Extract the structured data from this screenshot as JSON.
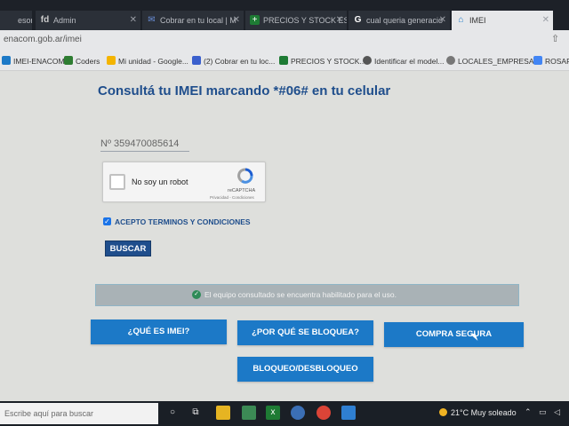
{
  "tabs": [
    {
      "label": "esor",
      "icon": ""
    },
    {
      "label": "Admin",
      "icon": "fd"
    },
    {
      "label": "Cobrar en tu local | M",
      "icon": "✉"
    },
    {
      "label": "PRECIOS Y STOCK ES",
      "icon": "+"
    },
    {
      "label": "cual queria generacio",
      "icon": "G"
    },
    {
      "label": "IMEI",
      "icon": "⌂"
    }
  ],
  "address": {
    "url": "enacom.gob.ar/imei"
  },
  "bookmarks": [
    {
      "label": "IMEI-ENACOM",
      "color": "#1c79c7"
    },
    {
      "label": "Coders",
      "color": "#2e7d32"
    },
    {
      "label": "Mi unidad - Google...",
      "color": "#f4b400"
    },
    {
      "label": "(2) Cobrar en tu loc...",
      "color": "#3a5fcd"
    },
    {
      "label": "PRECIOS Y STOCK...",
      "color": "#1e7b34"
    },
    {
      "label": "Identificar el model...",
      "color": "#555555"
    },
    {
      "label": "LOCALES_EMPRESA...",
      "color": "#777777"
    },
    {
      "label": "ROSAR",
      "color": "#4285f4"
    }
  ],
  "page": {
    "title": "Consultá tu IMEI marcando *#06# en tu celular",
    "imei_value": "Nº 359470085614",
    "captcha": {
      "text": "No soy un robot",
      "brand": "reCAPTCHA",
      "links": "Privacidad - Condiciones"
    },
    "terms_label": "ACEPTO TERMINOS Y CONDICIONES",
    "search_button": "BUSCAR",
    "status_message": "El equipo consultado se encuentra habilitado para el uso.",
    "buttons": {
      "what_is_imei": "¿QUÉ ES IMEI?",
      "why_blocked": "¿POR QUÉ SE BLOQUEA?",
      "secure_purchase": "COMPRA SEGURA",
      "block_unblock": "BLOQUEO/DESBLOQUEO"
    }
  },
  "taskbar": {
    "search_placeholder": "Escribe aquí para buscar",
    "weather": "21°C  Muy soleado"
  },
  "colors": {
    "accent": "#1c79c7",
    "title": "#1f4e8c",
    "status_bg": "#a9b2b6"
  }
}
